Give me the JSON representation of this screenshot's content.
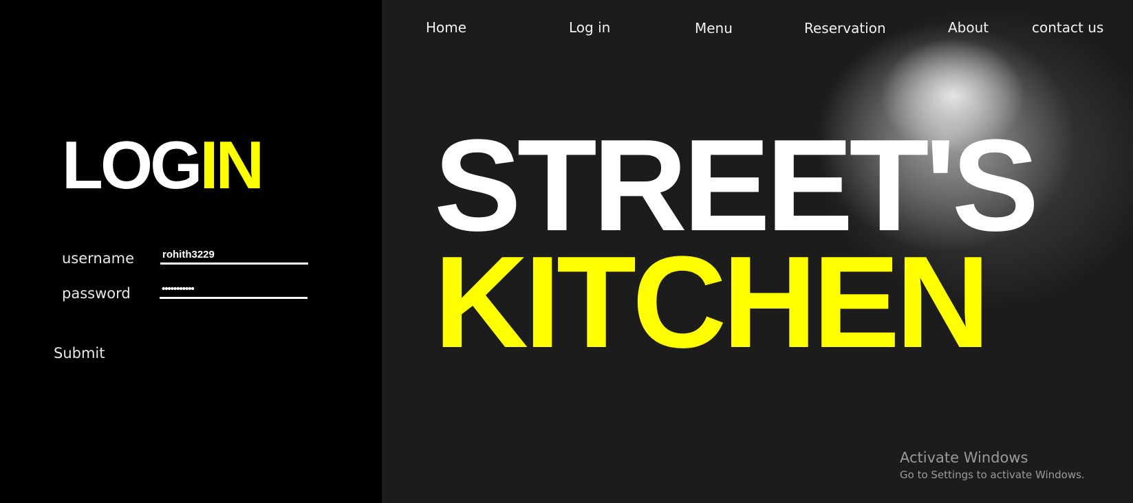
{
  "login": {
    "title_white": "LOG",
    "title_yellow": "IN",
    "username_label": "username",
    "username_value": "rohith3229",
    "password_label": "password",
    "password_value": "•••••••••••",
    "submit_label": "Submit"
  },
  "nav": {
    "items": [
      "Home",
      "Log in",
      "Menu",
      "Reservation",
      "About",
      "contact us"
    ]
  },
  "hero": {
    "line1": "STREET'S",
    "line2": "KITCHEN"
  },
  "watermark": {
    "title": "Activate Windows",
    "subtitle": "Go to Settings to activate Windows."
  },
  "colors": {
    "accent": "#ffff00",
    "text": "#ffffff",
    "background": "#000000"
  }
}
